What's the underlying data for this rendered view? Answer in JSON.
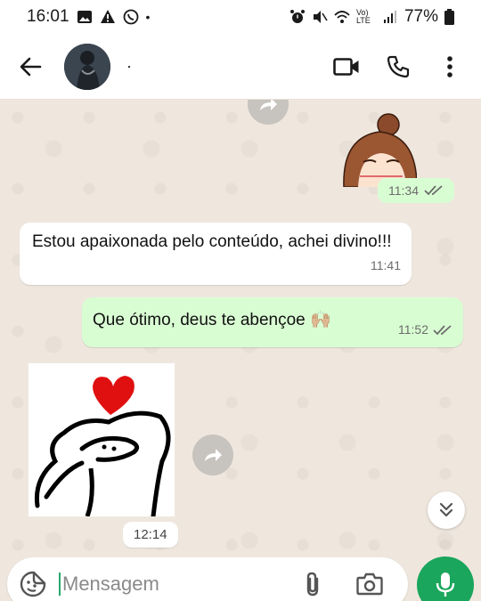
{
  "status_bar": {
    "time": "16:01",
    "battery": "77%",
    "network": "Vo) LTE"
  },
  "header": {
    "contact_name": "·"
  },
  "messages": [
    {
      "direction": "in",
      "text": "Estou apaixonada pelo conteúdo, achei divino!!!",
      "time": "11:41"
    },
    {
      "direction": "out",
      "text": "Que ótimo, deus te abençoe 🙌🏼",
      "time": "11:52"
    }
  ],
  "sticker_out_time": "11:34",
  "sticker_in_time": "12:14",
  "composer": {
    "placeholder": "Mensagem"
  },
  "colors": {
    "outgoing_bubble": "#d9fdd3",
    "incoming_bubble": "#ffffff",
    "mic_button": "#1aa65c",
    "read_ticks": "#6b6b6b"
  }
}
